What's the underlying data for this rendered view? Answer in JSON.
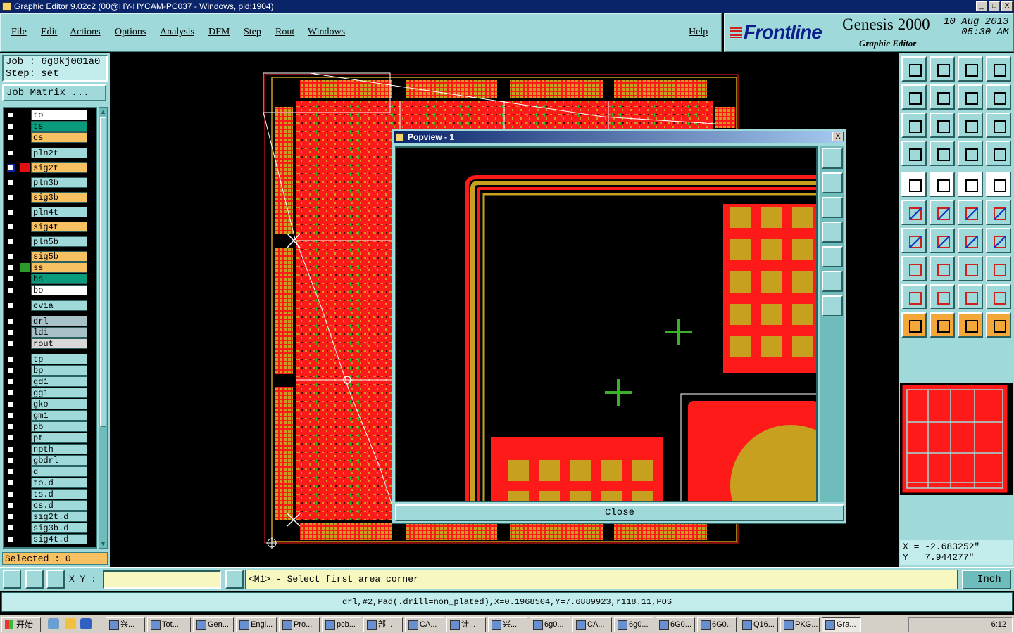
{
  "window": {
    "title": "Graphic Editor 9.02c2 (00@HY-HYCAM-PC037 - Windows, pid:1904)",
    "buttons": [
      "_",
      "□",
      "X"
    ]
  },
  "menubar": {
    "items": [
      "File",
      "Edit",
      "Actions",
      "Options",
      "Analysis",
      "DFM",
      "Step",
      "Rout",
      "Windows"
    ],
    "help": "Help"
  },
  "brand": {
    "logo": "Frontline",
    "product": "Genesis 2000",
    "subtitle": "Graphic Editor",
    "date": "10 Aug 2013",
    "time": "05:30 AM"
  },
  "job": {
    "job_line": "Job : 6g0kj001a0",
    "step_line": "Step: set",
    "matrix_button": "Job Matrix ..."
  },
  "layers": [
    {
      "name": "to",
      "color": "#ffffff",
      "sw": ""
    },
    {
      "name": "ts",
      "color": "#0a9b7d",
      "sw": ""
    },
    {
      "name": "cs",
      "color": "#f7c060",
      "sw": ""
    },
    {
      "name": "pln2t",
      "color": "#9fd9d9",
      "sw": ""
    },
    {
      "name": "sig2t",
      "color": "#f7c060",
      "sw": "#e01010",
      "active": true
    },
    {
      "name": "pln3b",
      "color": "#9fd9d9",
      "sw": ""
    },
    {
      "name": "sig3b",
      "color": "#f7c060",
      "sw": ""
    },
    {
      "name": "pln4t",
      "color": "#9fd9d9",
      "sw": ""
    },
    {
      "name": "sig4t",
      "color": "#f7c060",
      "sw": ""
    },
    {
      "name": "pln5b",
      "color": "#9fd9d9",
      "sw": ""
    },
    {
      "name": "sig5b",
      "color": "#f7c060",
      "sw": ""
    },
    {
      "name": "ss",
      "color": "#f7c060",
      "sw": "#2a9a2a"
    },
    {
      "name": "bs",
      "color": "#0a9b7d",
      "sw": ""
    },
    {
      "name": "bo",
      "color": "#ffffff",
      "sw": ""
    },
    {
      "name": "cvia",
      "color": "#9fd9d9",
      "sw": ""
    },
    {
      "name": "drl",
      "color": "#a8c0c8",
      "sw": ""
    },
    {
      "name": "ldi",
      "color": "#a8c0c8",
      "sw": ""
    },
    {
      "name": "rout",
      "color": "#d8d8d8",
      "sw": ""
    },
    {
      "name": "tp",
      "color": "#9fd9d9",
      "sw": ""
    },
    {
      "name": "bp",
      "color": "#9fd9d9",
      "sw": ""
    },
    {
      "name": "gd1",
      "color": "#9fd9d9",
      "sw": ""
    },
    {
      "name": "gg1",
      "color": "#9fd9d9",
      "sw": ""
    },
    {
      "name": "gko",
      "color": "#9fd9d9",
      "sw": ""
    },
    {
      "name": "gm1",
      "color": "#9fd9d9",
      "sw": ""
    },
    {
      "name": "pb",
      "color": "#9fd9d9",
      "sw": ""
    },
    {
      "name": "pt",
      "color": "#9fd9d9",
      "sw": ""
    },
    {
      "name": "npth",
      "color": "#9fd9d9",
      "sw": ""
    },
    {
      "name": "gbdrl",
      "color": "#9fd9d9",
      "sw": ""
    },
    {
      "name": "d",
      "color": "#9fd9d9",
      "sw": ""
    },
    {
      "name": "to.d",
      "color": "#9fd9d9",
      "sw": ""
    },
    {
      "name": "ts.d",
      "color": "#9fd9d9",
      "sw": ""
    },
    {
      "name": "cs.d",
      "color": "#9fd9d9",
      "sw": ""
    },
    {
      "name": "sig2t.d",
      "color": "#9fd9d9",
      "sw": ""
    },
    {
      "name": "sig3b.d",
      "color": "#9fd9d9",
      "sw": ""
    },
    {
      "name": "sig4t.d",
      "color": "#9fd9d9",
      "sw": ""
    }
  ],
  "selected": "Selected : 0",
  "popup": {
    "title": "Popview - 1",
    "close_x": "X",
    "close_button": "Close"
  },
  "coords": {
    "x": "X = -2.683252\"",
    "y": "Y = 7.944277\""
  },
  "command": {
    "xy_label": "X Y :",
    "xy_value": "",
    "prompt": "<M1> - Select first area corner",
    "units": "Inch"
  },
  "info": "drl,#2,Pad(.drill=non_plated),X=0.1968504,Y=7.6889923,r118.11,POS",
  "taskbar": {
    "start": "开始",
    "apps": [
      "兴...",
      "Tot...",
      "Gen...",
      "Engi...",
      "Pro...",
      "pcb...",
      "部...",
      "CA...",
      "计...",
      "兴...",
      "6g0...",
      "CA...",
      "6g0...",
      "6G0...",
      "6G0...",
      "Q16...",
      "PKG...",
      "Gra..."
    ],
    "clock": "6:12"
  },
  "colors": {
    "panel": "#9fd9d9",
    "copper_red": "#ff1a1a",
    "pad_gold": "#c8a020",
    "cross_green": "#3cb02a"
  }
}
